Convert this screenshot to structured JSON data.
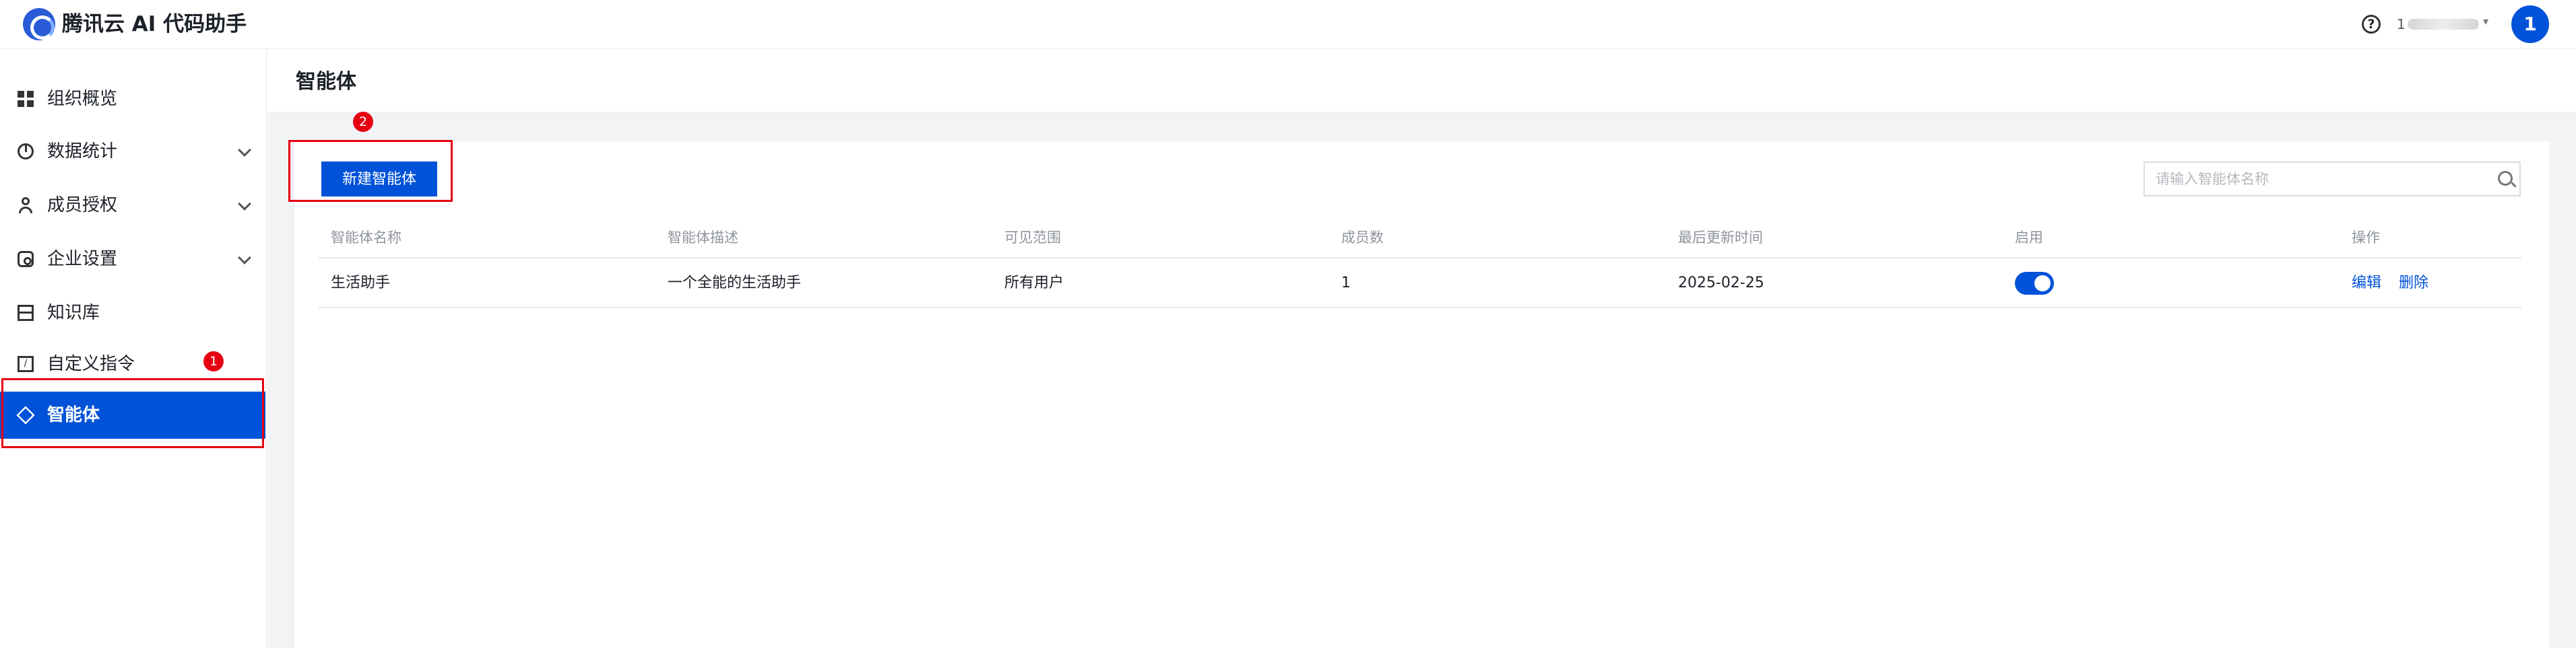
{
  "app": {
    "brand": "腾讯云 AI 代码助手"
  },
  "header": {
    "help_icon": "?",
    "account_id": "1",
    "avatar_text": "1"
  },
  "sidebar": {
    "items": [
      {
        "label": "组织概览",
        "icon": "grid-icon",
        "expandable": false
      },
      {
        "label": "数据统计",
        "icon": "pie-chart-icon",
        "expandable": true
      },
      {
        "label": "成员授权",
        "icon": "user-icon",
        "expandable": true
      },
      {
        "label": "企业设置",
        "icon": "gear-icon",
        "expandable": true
      },
      {
        "label": "知识库",
        "icon": "book-icon",
        "expandable": false
      },
      {
        "label": "自定义指令",
        "icon": "command-icon",
        "expandable": false
      },
      {
        "label": "智能体",
        "icon": "cube-icon",
        "expandable": false,
        "active": true
      }
    ]
  },
  "main": {
    "title": "智能体",
    "new_button": "新建智能体",
    "search": {
      "placeholder": "请输入智能体名称",
      "value": ""
    },
    "table": {
      "columns": [
        "智能体名称",
        "智能体描述",
        "可见范围",
        "成员数",
        "最后更新时间",
        "启用",
        "操作"
      ],
      "rows": [
        {
          "name": "生活助手",
          "description": "一个全能的生活助手",
          "visibility": "所有用户",
          "members": "1",
          "updated": "2025-02-25",
          "enabled": true,
          "actions": [
            "编辑",
            "删除"
          ]
        }
      ]
    }
  },
  "annotations": {
    "badge_1": "1",
    "badge_2": "2",
    "color": "#e60012"
  },
  "colors": {
    "accent": "#0052d9",
    "page_bg": "#f2f3f5",
    "annotation": "#e60012"
  }
}
